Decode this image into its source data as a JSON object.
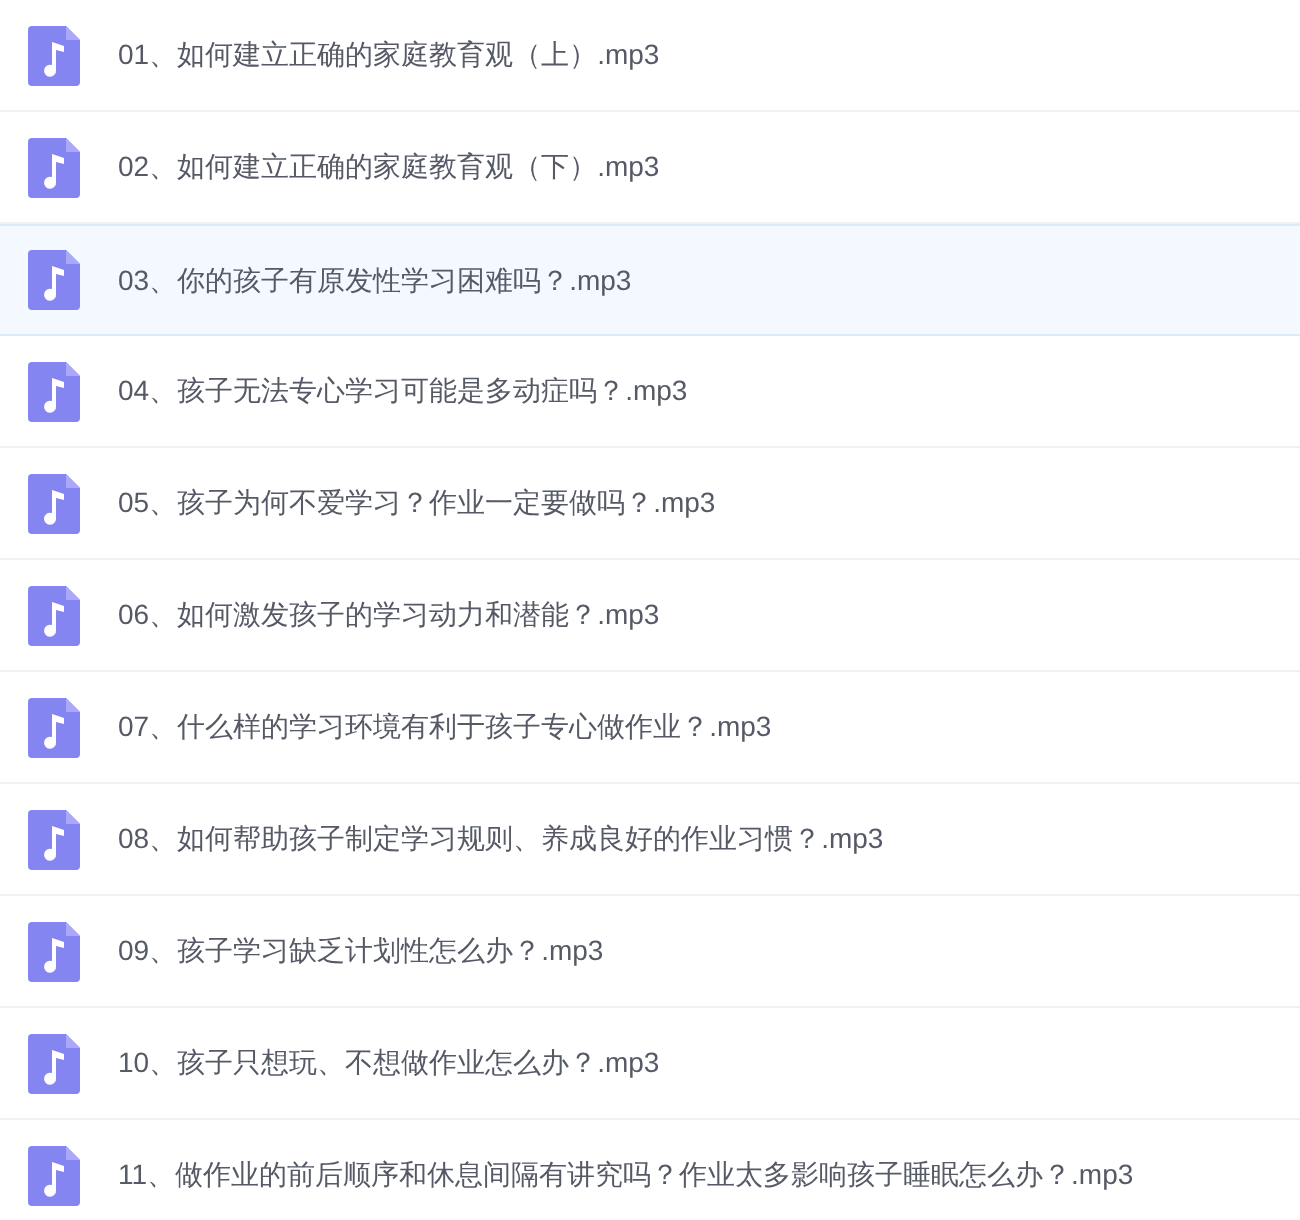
{
  "files": [
    {
      "name": "01、如何建立正确的家庭教育观（上）.mp3",
      "selected": false
    },
    {
      "name": "02、如何建立正确的家庭教育观（下）.mp3",
      "selected": false
    },
    {
      "name": "03、你的孩子有原发性学习困难吗？.mp3",
      "selected": true
    },
    {
      "name": "04、孩子无法专心学习可能是多动症吗？.mp3",
      "selected": false
    },
    {
      "name": "05、孩子为何不爱学习？作业一定要做吗？.mp3",
      "selected": false
    },
    {
      "name": "06、如何激发孩子的学习动力和潜能？.mp3",
      "selected": false
    },
    {
      "name": "07、什么样的学习环境有利于孩子专心做作业？.mp3",
      "selected": false
    },
    {
      "name": "08、如何帮助孩子制定学习规则、养成良好的作业习惯？.mp3",
      "selected": false
    },
    {
      "name": "09、孩子学习缺乏计划性怎么办？.mp3",
      "selected": false
    },
    {
      "name": "10、孩子只想玩、不想做作业怎么办？.mp3",
      "selected": false
    },
    {
      "name": "11、做作业的前后顺序和休息间隔有讲究吗？作业太多影响孩子睡眠怎么办？.mp3",
      "selected": false
    }
  ]
}
